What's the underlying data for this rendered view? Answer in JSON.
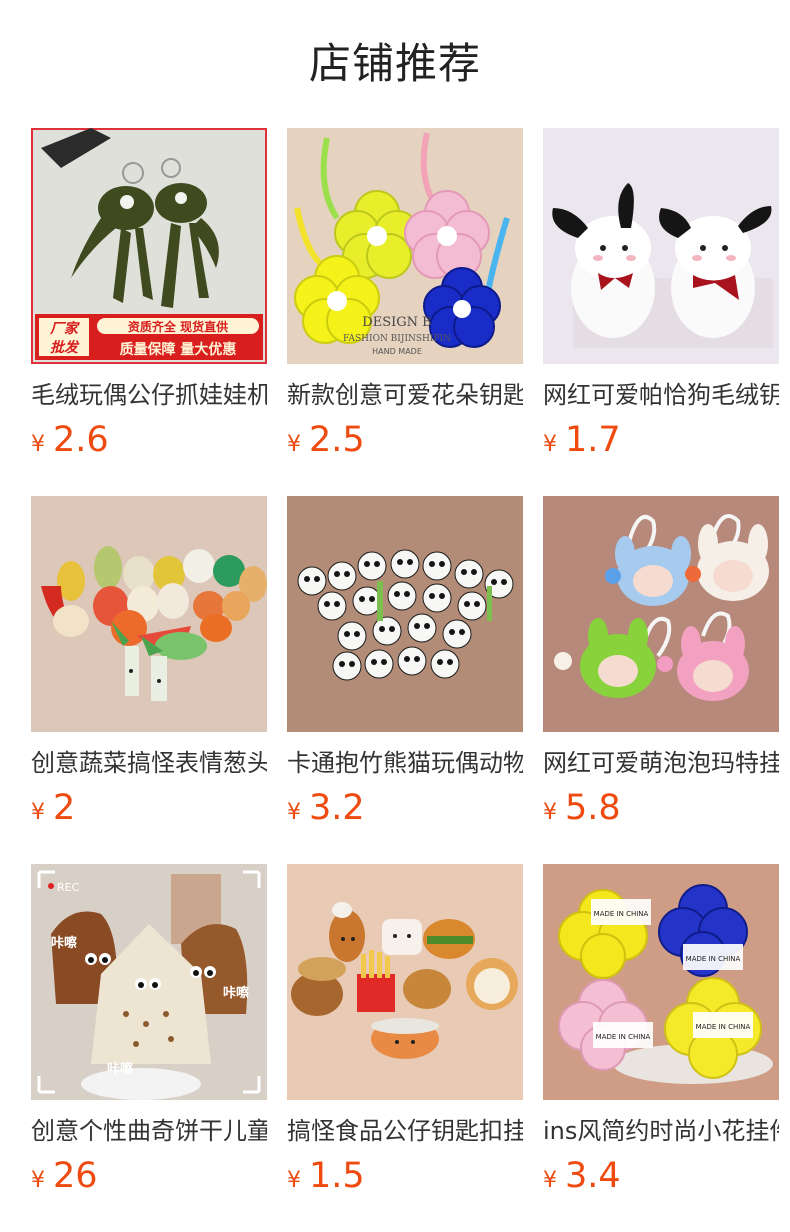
{
  "header": {
    "title": "店铺推荐"
  },
  "products": [
    {
      "name": "毛绒玩偶公仔抓娃娃机钥匙扣挂件",
      "currency": "¥",
      "price": "2.6",
      "bg": "#dcdcd6",
      "badge": {
        "left_text_1": "厂家",
        "left_text_2": "批发",
        "right_text_1": "资质齐全 现货直供",
        "right_text_2": "质量保障 量大优惠"
      }
    },
    {
      "name": "新款创意可爱花朵钥匙扣挂件",
      "currency": "¥",
      "price": "2.5",
      "bg": "#e6d3bf",
      "sign": {
        "line1": "DESIGN B",
        "line2": "FASHION BIJINSHIPIN",
        "line3": "HAND MADE"
      }
    },
    {
      "name": "网红可爱帕恰狗毛绒钥匙扣",
      "currency": "¥",
      "price": "1.7",
      "bg": "#ece6ee"
    },
    {
      "name": "创意蔬菜搞怪表情葱头毛绒挂件",
      "currency": "¥",
      "price": "2",
      "bg": "#dcc7b8"
    },
    {
      "name": "卡通抱竹熊猫玩偶动物挂件",
      "currency": "¥",
      "price": "3.2",
      "bg": "#b38c78"
    },
    {
      "name": "网红可爱萌泡泡玛特挂件",
      "currency": "¥",
      "price": "5.8",
      "bg": "#b7897a"
    },
    {
      "name": "创意个性曲奇饼干儿童背包",
      "currency": "¥",
      "price": "26",
      "bg": "#d8cfc6",
      "overlay": {
        "rec": "REC",
        "sound1": "咔嚓",
        "sound2": "咔嚓",
        "sound3": "咔嚓"
      }
    },
    {
      "name": "搞怪食品公仔钥匙扣挂件",
      "currency": "¥",
      "price": "1.5",
      "bg": "#e9cbb5"
    },
    {
      "name": "ins风简约时尚小花挂件",
      "currency": "¥",
      "price": "3.4",
      "bg": "#cf9c85",
      "tags": {
        "tag1": "MADE IN CHINA",
        "tag2": "MADE IN CHINA",
        "tag3": "MADE IN CHINA",
        "tag4": "MADE IN CHINA"
      }
    }
  ],
  "colors": {
    "price": "#ef4a10",
    "badge_red": "#d91e1e",
    "badge_cream": "#fff4d6"
  }
}
